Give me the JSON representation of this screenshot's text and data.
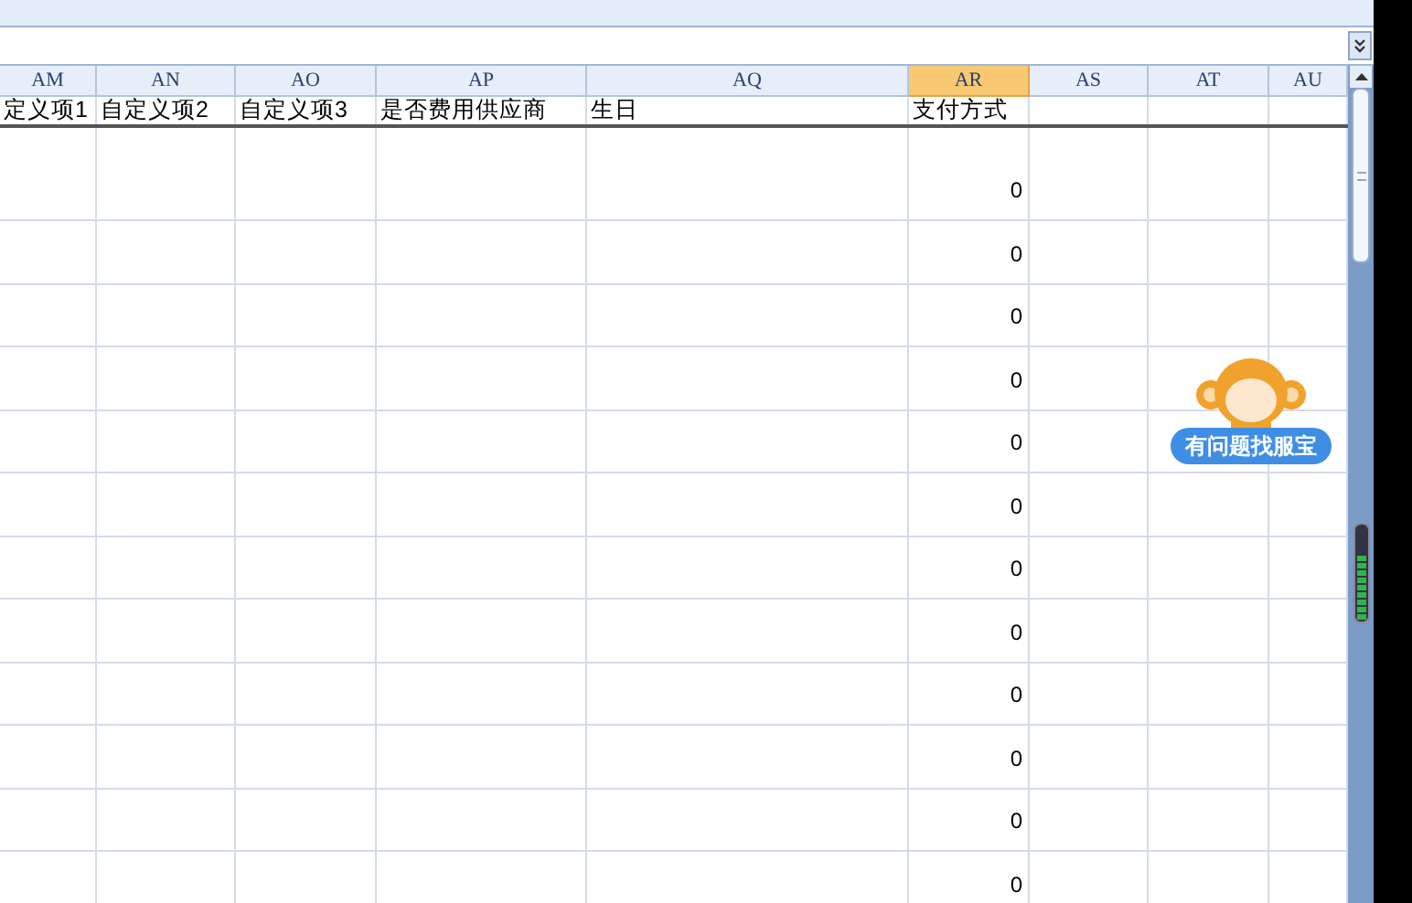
{
  "columns": [
    {
      "letter": "AM",
      "heading": "定义项1",
      "selected": false
    },
    {
      "letter": "AN",
      "heading": "自定义项2",
      "selected": false
    },
    {
      "letter": "AO",
      "heading": "自定义项3",
      "selected": false
    },
    {
      "letter": "AP",
      "heading": "是否费用供应商",
      "selected": false
    },
    {
      "letter": "AQ",
      "heading": "生日",
      "selected": false
    },
    {
      "letter": "AR",
      "heading": "支付方式",
      "selected": true
    },
    {
      "letter": "AS",
      "selected": false
    },
    {
      "letter": "AT",
      "selected": false
    },
    {
      "letter": "AU",
      "selected": false
    }
  ],
  "rows": [
    {
      "payment_method": "0"
    },
    {
      "payment_method": "0"
    },
    {
      "payment_method": "0"
    },
    {
      "payment_method": "0"
    },
    {
      "payment_method": "0"
    },
    {
      "payment_method": "0"
    },
    {
      "payment_method": "0"
    },
    {
      "payment_method": "0"
    },
    {
      "payment_method": "0"
    },
    {
      "payment_method": "0"
    },
    {
      "payment_method": "0"
    },
    {
      "payment_method": "0"
    }
  ],
  "help_badge": {
    "label": "有问题找服宝"
  }
}
